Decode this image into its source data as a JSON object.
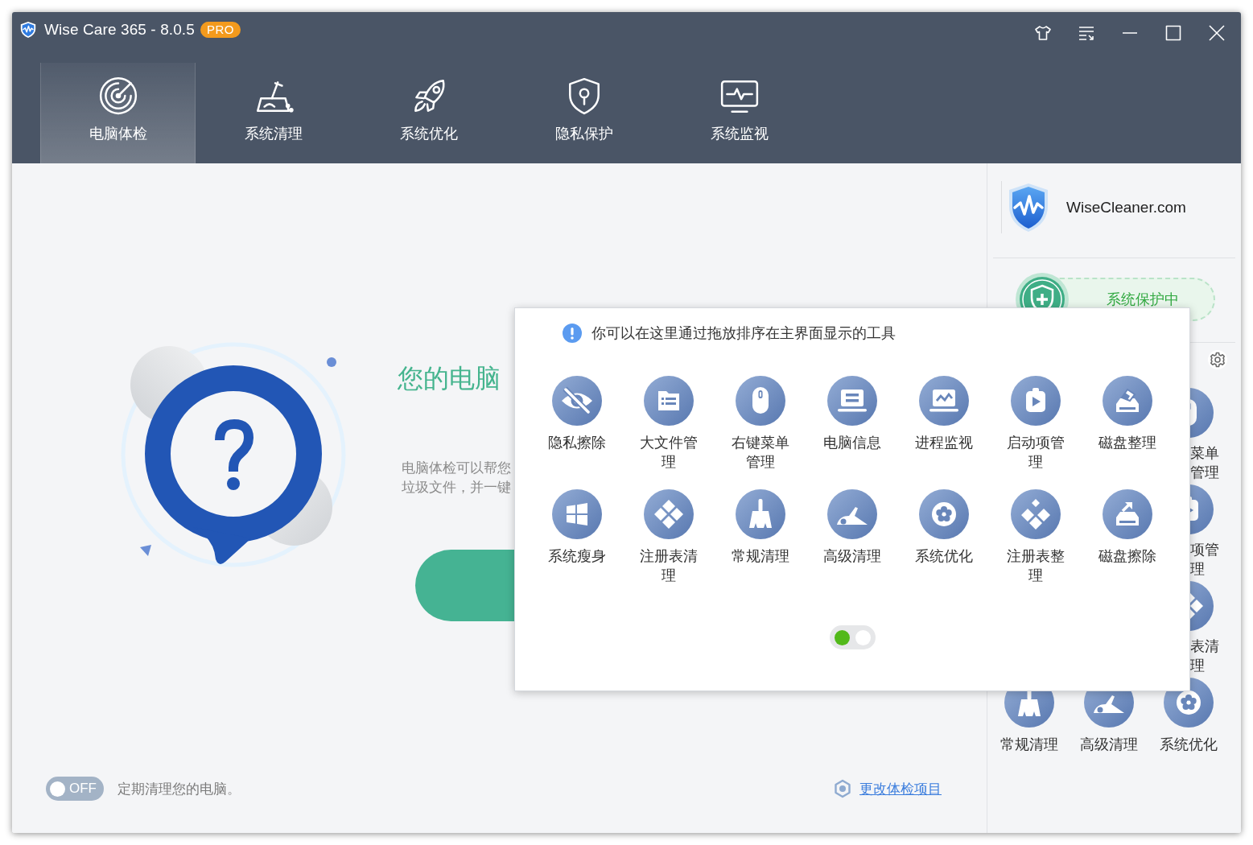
{
  "window": {
    "title": "Wise Care 365 - 8.0.5",
    "badge": "PRO"
  },
  "tabs": [
    {
      "label": "电脑体检",
      "kind": "checkup",
      "selected": true
    },
    {
      "label": "系统清理",
      "kind": "clean",
      "selected": false
    },
    {
      "label": "系统优化",
      "kind": "optimize",
      "selected": false
    },
    {
      "label": "隐私保护",
      "kind": "privacy",
      "selected": false
    },
    {
      "label": "系统监视",
      "kind": "monitor",
      "selected": false
    }
  ],
  "main": {
    "heading": "您的电脑",
    "description": [
      "电脑体检可以帮您",
      "垃圾文件，并一键"
    ],
    "schedule": {
      "toggle": {
        "label": "OFF",
        "on": false
      },
      "text": "定期清理您的电脑。"
    },
    "change_items_link": "更改体检项目"
  },
  "sidebar": {
    "site": "WiseCleaner.com",
    "protection": {
      "label": "系统保护中",
      "on": true
    },
    "tools": [
      {
        "kind": "menu",
        "covered": true,
        "lines": [
          "菜单",
          "管理"
        ]
      },
      {
        "kind": "startup",
        "covered": true,
        "lines": [
          "项管",
          "理"
        ]
      },
      {
        "kind": "registry",
        "covered": true,
        "lines": [
          "表清",
          "理"
        ]
      },
      {
        "kind": "clean",
        "covered": false,
        "lines": [
          "常规清理"
        ]
      },
      {
        "kind": "deepclean",
        "covered": false,
        "lines": [
          "高级清理"
        ]
      },
      {
        "kind": "optimize",
        "covered": false,
        "lines": [
          "系统优化"
        ]
      }
    ]
  },
  "popup": {
    "hint": "你可以在这里通过拖放排序在主界面显示的工具",
    "tools": [
      {
        "label": "隐私擦除",
        "kind": "privacy"
      },
      {
        "label": "大文件管理",
        "kind": "files"
      },
      {
        "label": "右键菜单管理",
        "kind": "menu"
      },
      {
        "label": "电脑信息",
        "kind": "info"
      },
      {
        "label": "进程监视",
        "kind": "monitor"
      },
      {
        "label": "启动项管理",
        "kind": "startup"
      },
      {
        "label": "磁盘整理",
        "kind": "defrag"
      },
      {
        "label": "系统瘦身",
        "kind": "slim"
      },
      {
        "label": "注册表清理",
        "kind": "registry"
      },
      {
        "label": "常规清理",
        "kind": "clean"
      },
      {
        "label": "高级清理",
        "kind": "deepclean"
      },
      {
        "label": "系统优化",
        "kind": "optimize"
      },
      {
        "label": "注册表整理",
        "kind": "regdefrag"
      },
      {
        "label": "磁盘擦除",
        "kind": "wipe"
      }
    ],
    "pages": [
      {
        "selected": true
      },
      {
        "selected": false
      }
    ]
  }
}
